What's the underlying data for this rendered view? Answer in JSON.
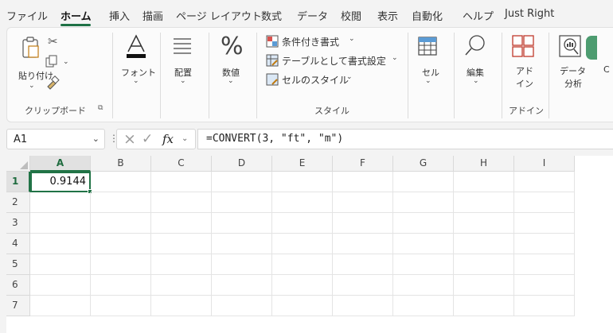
{
  "tabs": [
    {
      "label": "ファイル",
      "active": false
    },
    {
      "label": "ホーム",
      "active": true
    },
    {
      "label": "挿入",
      "active": false
    },
    {
      "label": "描画",
      "active": false
    },
    {
      "label": "ページ レイアウト",
      "active": false
    },
    {
      "label": "数式",
      "active": false
    },
    {
      "label": "データ",
      "active": false
    },
    {
      "label": "校閲",
      "active": false
    },
    {
      "label": "表示",
      "active": false
    },
    {
      "label": "自動化",
      "active": false
    },
    {
      "label": "ヘルプ",
      "active": false
    },
    {
      "label": "Just Right",
      "active": false
    }
  ],
  "ribbon": {
    "clipboard": {
      "paste_label": "貼り付け",
      "group_label": "クリップボード"
    },
    "font": {
      "label": "フォント"
    },
    "alignment": {
      "label": "配置"
    },
    "number": {
      "label": "数値"
    },
    "styles": {
      "conditional": "条件付き書式",
      "table": "テーブルとして書式設定",
      "cell_styles": "セルのスタイル",
      "group_label": "スタイル"
    },
    "cells": {
      "label": "セル"
    },
    "editing": {
      "label": "編集"
    },
    "addins": {
      "label_line1": "アド",
      "label_line2": "イン",
      "group_label": "アドイン"
    },
    "analysis": {
      "label_line1": "データ",
      "label_line2": "分析",
      "cut_label": "C"
    }
  },
  "formula_bar": {
    "name_box": "A1",
    "formula": "=CONVERT(3, \"ft\", \"m\")"
  },
  "sheet": {
    "columns": [
      "A",
      "B",
      "C",
      "D",
      "E",
      "F",
      "G",
      "H",
      "I"
    ],
    "rows": [
      "1",
      "2",
      "3",
      "4",
      "5",
      "6",
      "7"
    ],
    "selected_column": "A",
    "selected_row": "1",
    "cells": {
      "A1": "0.9144"
    }
  },
  "colors": {
    "accent": "#217346",
    "grid": "#e4e4e4"
  }
}
